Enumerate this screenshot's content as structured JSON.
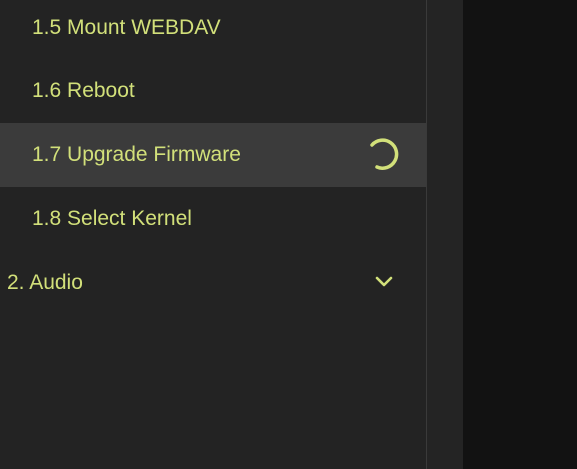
{
  "sidebar": {
    "items": [
      {
        "label": "1.5 Mount WEBDAV"
      },
      {
        "label": "1.6 Reboot"
      },
      {
        "label": "1.7 Upgrade Firmware"
      },
      {
        "label": "1.8 Select Kernel"
      },
      {
        "label": "2. Audio"
      }
    ]
  },
  "colors": {
    "accent": "#d2e07a",
    "sidebar_bg": "#232323",
    "active_bg": "#3b3b3b",
    "main_bg": "#121212"
  },
  "icons": {
    "loading": "spinner-icon",
    "expand": "chevron-down-icon"
  }
}
